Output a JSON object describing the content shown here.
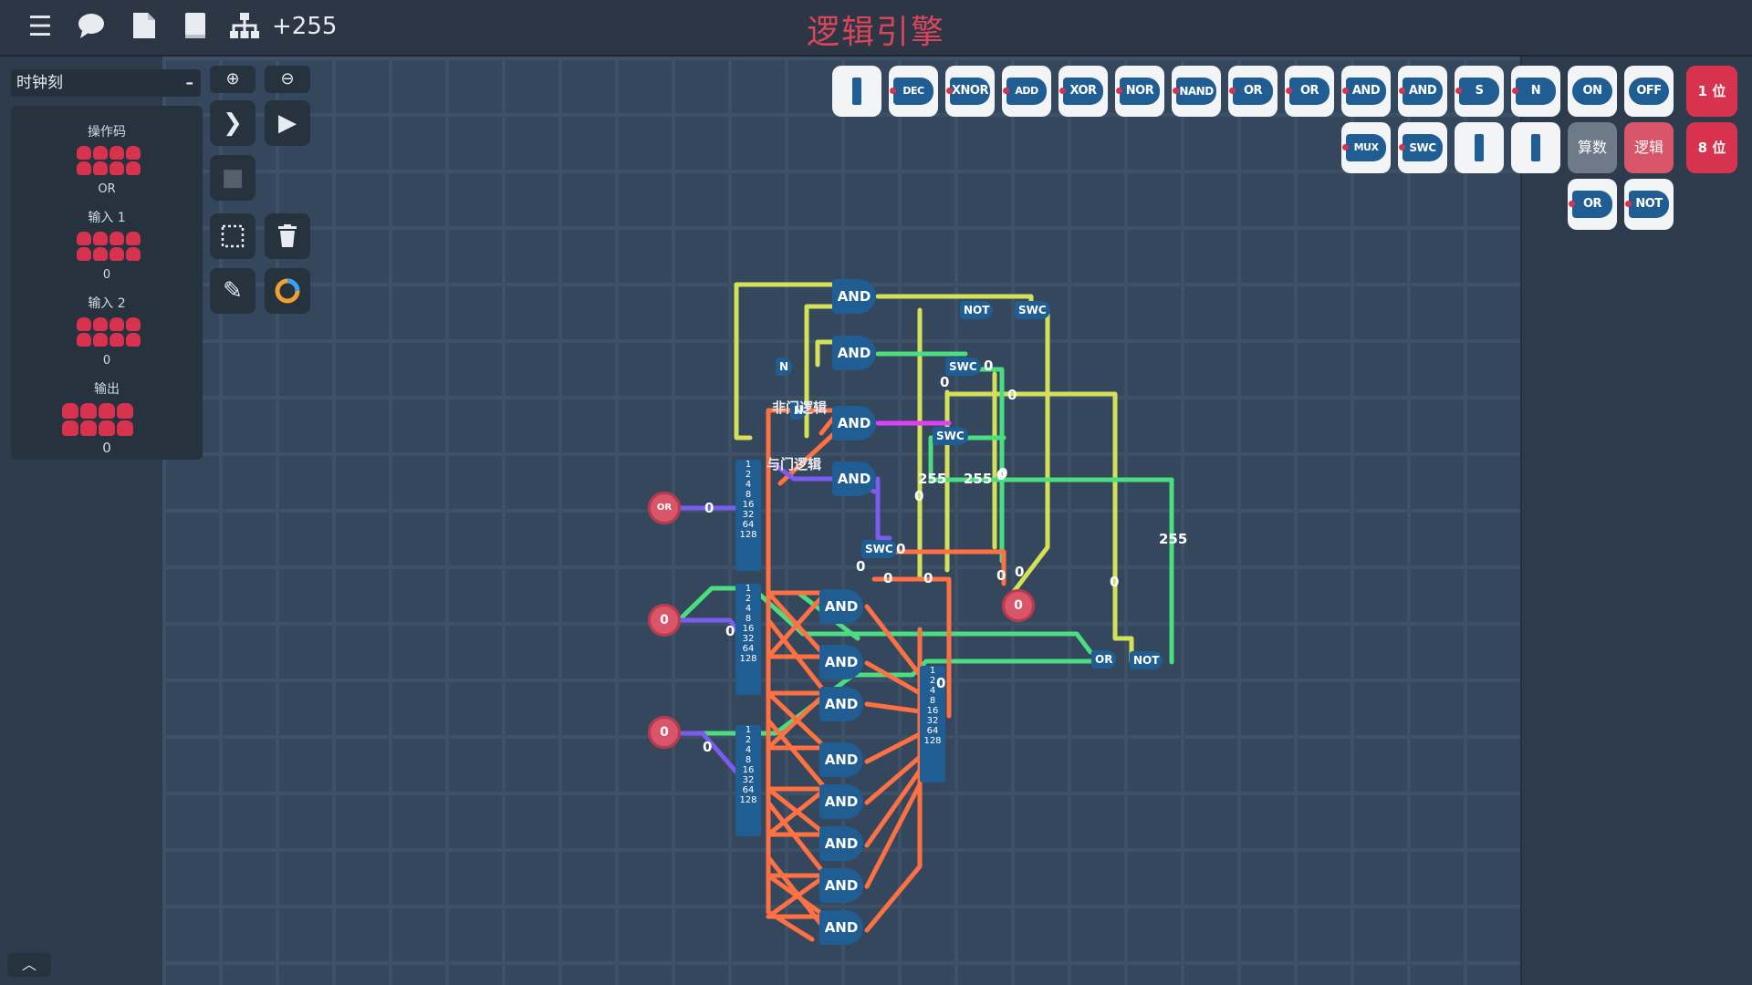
{
  "topbar": {
    "title": "逻辑引擎",
    "component_count": "+255",
    "icons": [
      "menu-icon",
      "chat-icon",
      "file-icon",
      "book-icon",
      "hierarchy-icon"
    ]
  },
  "left_panel": {
    "clock_label": "时钟刻",
    "clock_minus": "–",
    "sections": [
      {
        "label": "操作码",
        "value": "OR"
      },
      {
        "label": "输入 1",
        "value": "0"
      },
      {
        "label": "输入 2",
        "value": "0"
      },
      {
        "label": "输出",
        "value": "0"
      }
    ]
  },
  "tools": [
    "zoom-in-icon",
    "zoom-out-icon",
    "step-icon",
    "play-icon",
    "stop-icon",
    "select-icon",
    "delete-icon",
    "pencil-icon",
    "color-ring-icon"
  ],
  "palette": {
    "row1": [
      "",
      "DEC",
      "XNOR",
      "ADD",
      "XOR",
      "NOR",
      "NAND",
      "OR",
      "OR",
      "AND",
      "AND",
      "S",
      "N",
      "ON",
      "OFF"
    ],
    "row2": [
      "MUX",
      "SWC",
      "",
      ""
    ],
    "row3": [
      "OR",
      "NOT"
    ],
    "categories": {
      "arith": "算数",
      "logic": "逻辑"
    },
    "bit_buttons": {
      "one": "1 位",
      "eight": "8 位"
    }
  },
  "circuit": {
    "inputs": [
      {
        "label": "OR"
      },
      {
        "label": "0"
      },
      {
        "label": "0"
      }
    ],
    "output": {
      "label": "0"
    },
    "overlay_labels": [
      "与门逻辑",
      "非门逻辑"
    ],
    "bus_bits": [
      "1",
      "2",
      "4",
      "8",
      "16",
      "32",
      "64",
      "128"
    ],
    "and_gate": "AND",
    "gates_top": [
      "AND",
      "AND",
      "N",
      "N",
      "AND",
      "AND"
    ],
    "small_gates": [
      "NOT",
      "SWC",
      "SWC",
      "SWC",
      "SWC",
      "OR",
      "NOT"
    ],
    "wire_values": [
      "0",
      "0",
      "0",
      "0",
      "0",
      "0",
      "0",
      "0",
      "0",
      "0",
      "0",
      "0",
      "0",
      "0",
      "255",
      "255",
      "255",
      "0",
      "0",
      "0"
    ]
  },
  "colors": {
    "accent": "#d8334e",
    "gate": "#1f5d93",
    "wire_yellow": "#d4e157",
    "wire_green": "#4ade80",
    "wire_orange": "#ff7043",
    "wire_purple": "#7c5cf0",
    "wire_magenta": "#e040fb"
  }
}
